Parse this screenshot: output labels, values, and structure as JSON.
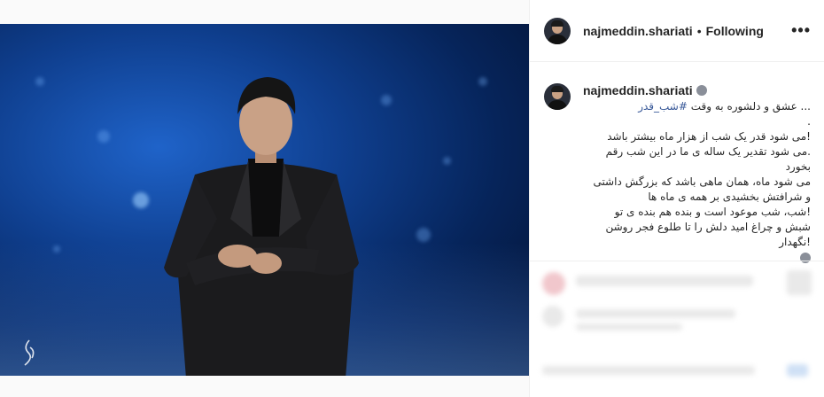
{
  "post": {
    "image_alt": "Man in black suit checking his watch on a blue bokeh stage"
  },
  "header": {
    "username": "najmeddin.shariati",
    "separator": "•",
    "follow_status": "Following",
    "more_label": "•••"
  },
  "caption": {
    "username": "najmeddin.shariati",
    "lines": [
      "... عشق و دلشوره به وقت #شب_قدر",
      ".",
      "!می شود قدر یک شب از هزار ماه بیشتر باشد",
      ".می شود تقدیر یک ساله ی ما در این شب رقم بخورد",
      "می شود ماه، همان ماهی باشد که بزرگش داشتی",
      "و شرافتش بخشیدی بر همه ی ماه ها",
      "!شب، شب موعود است و بنده هم بنده ی تو",
      "شبش و چراغ امید دلش را تا طلوع فجر روشن",
      "!نگهدار"
    ]
  },
  "colors": {
    "text": "#262626",
    "hashtag": "#385898",
    "border": "#efefef"
  }
}
